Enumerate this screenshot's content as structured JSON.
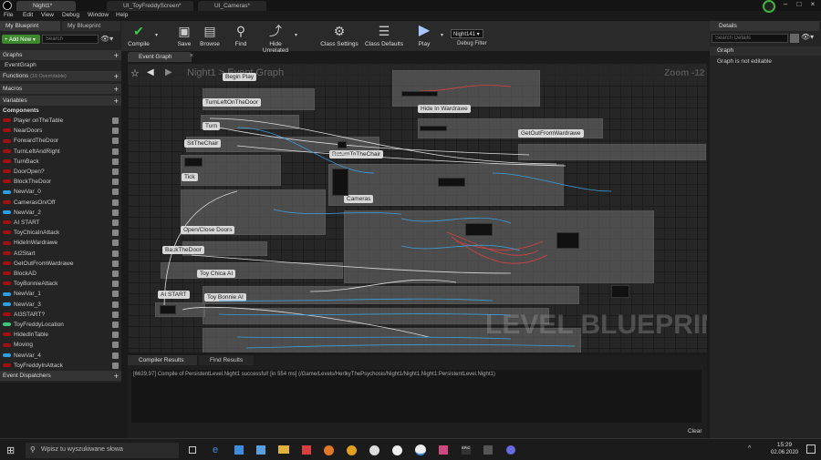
{
  "tabs": [
    "Night1*",
    "UI_ToyFreddyScreen*",
    "UI_Cameras*"
  ],
  "menu": [
    "File",
    "Edit",
    "View",
    "Debug",
    "Window",
    "Help"
  ],
  "left": {
    "my_blueprint_tab": "My Blueprint",
    "my_blueprint_tab2": "My Blueprint",
    "add_new": "+ Add New ▾",
    "search_placeholder": "Search",
    "graphs": "Graphs",
    "event_graph": "EventGraph",
    "functions": "Functions",
    "functions_count": "(19 Overridable)",
    "macros": "Macros",
    "variables": "Variables",
    "components": "Components",
    "event_dispatchers": "Event Dispatchers",
    "vars": [
      {
        "name": "Player onTheTable",
        "color": "#a01010"
      },
      {
        "name": "NearDoors",
        "color": "#a01010"
      },
      {
        "name": "ForwardTheDoor",
        "color": "#a01010"
      },
      {
        "name": "TurnLeftAndRight",
        "color": "#a01010"
      },
      {
        "name": "TurnBack",
        "color": "#a01010"
      },
      {
        "name": "DoorOpen?",
        "color": "#a01010"
      },
      {
        "name": "BlockTheDoor",
        "color": "#a01010"
      },
      {
        "name": "NewVar_0",
        "color": "#2aa0e0"
      },
      {
        "name": "CamerasOn/Off",
        "color": "#a01010"
      },
      {
        "name": "NewVar_2",
        "color": "#2aa0e0"
      },
      {
        "name": "AI START",
        "color": "#a01010"
      },
      {
        "name": "ToyChicaInAttack",
        "color": "#a01010"
      },
      {
        "name": "HideInWardrawe",
        "color": "#a01010"
      },
      {
        "name": "AI2Start",
        "color": "#a01010"
      },
      {
        "name": "GetOutFromWardrawe",
        "color": "#a01010"
      },
      {
        "name": "BlockAD",
        "color": "#a01010"
      },
      {
        "name": "ToyBonnieAttack",
        "color": "#a01010"
      },
      {
        "name": "NewVar_1",
        "color": "#2aa0e0"
      },
      {
        "name": "NewVar_3",
        "color": "#2aa0e0"
      },
      {
        "name": "AI3START?",
        "color": "#a01010"
      },
      {
        "name": "ToyFreddyLocation",
        "color": "#3cc878"
      },
      {
        "name": "HidedInTable",
        "color": "#a01010"
      },
      {
        "name": "Moving",
        "color": "#a01010"
      },
      {
        "name": "NewVar_4",
        "color": "#2aa0e0"
      },
      {
        "name": "ToyFreddyInAttack",
        "color": "#a01010"
      }
    ]
  },
  "toolbar": {
    "compile": "Compile",
    "save": "Save",
    "browse": "Browse",
    "find": "Find",
    "hide_unrelated": "Hide Unrelated",
    "class_settings": "Class Settings",
    "class_defaults": "Class Defaults",
    "play": "Play",
    "debug_select": "Night141 ▾",
    "debug_filter": "Debug Filter"
  },
  "graph": {
    "tab": "Event Graph",
    "breadcrumb_root": "Night1",
    "breadcrumb_sep": ">",
    "breadcrumb_leaf": "Event Graph",
    "zoom": "Zoom -12",
    "watermark": "LEVEL BLUEPRINT",
    "comments": [
      "Begin Play",
      "TurnLeftOnTheDoor",
      "Turn",
      "SitTheChair",
      "Tick",
      "Hide In Wardrawe",
      "GetOutFromWardrawe",
      "ReturnToTheChair",
      "Cameras",
      "Open/Close Doors",
      "BackTheDoor",
      "Toy Chica AI",
      "AI START",
      "Toy Bonnie AI"
    ]
  },
  "details": {
    "title": "Details",
    "search_placeholder": "Search Details",
    "graph_header": "Graph",
    "graph_note": "Graph is not editable"
  },
  "bottom": {
    "compiler_results": "Compiler Results",
    "find_results": "Find Results",
    "log": "[6629,97] Compile of PersistentLevel.Night1 successful! [in 554 ms] (/Game/Levels/HerlkyThePsychosis/Night1/Night1.Night1:PersistentLevel.Night1)",
    "clear": "Clear"
  },
  "taskbar": {
    "search_placeholder": "Wpisz tu wyszukiwane słowa",
    "time": "15:29",
    "date": "02.06.2020"
  }
}
